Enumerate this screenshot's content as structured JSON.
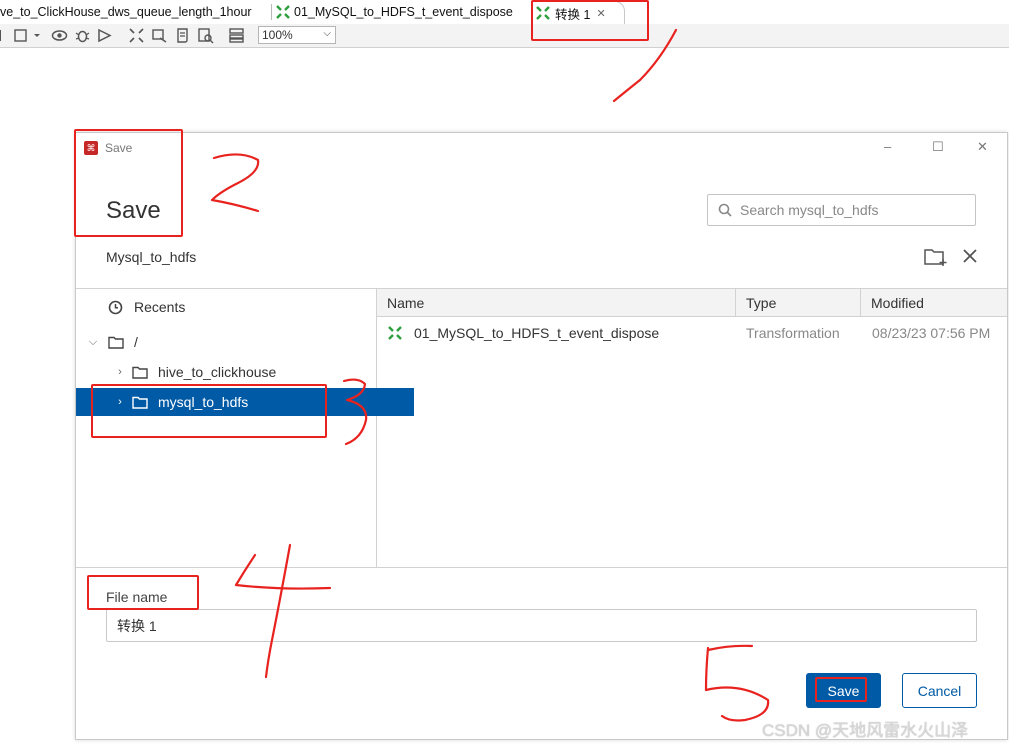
{
  "tabs": [
    {
      "label": "ve_to_ClickHouse_dws_queue_length_1hour"
    },
    {
      "label": "01_MySQL_to_HDFS_t_event_dispose"
    },
    {
      "label": "转换 1"
    }
  ],
  "toolbar": {
    "zoom": "100%"
  },
  "dialog": {
    "window_title": "Save",
    "heading": "Save",
    "search_placeholder": "Search mysql_to_hdfs",
    "current_path": "Mysql_to_hdfs",
    "tree": {
      "recents": "Recents",
      "root": "/",
      "folders": [
        "hive_to_clickhouse",
        "mysql_to_hdfs"
      ]
    },
    "columns": {
      "name": "Name",
      "type": "Type",
      "modified": "Modified"
    },
    "files": [
      {
        "name": "01_MySQL_to_HDFS_t_event_dispose",
        "type": "Transformation",
        "modified": "08/23/23 07:56 PM"
      }
    ],
    "file_name_label": "File name",
    "file_name_value": "转换 1",
    "save_button": "Save",
    "cancel_button": "Cancel"
  },
  "watermark": "CSDN @天地风雷水火山泽",
  "colors": {
    "accent": "#005aa5",
    "annotation": "#e8231f"
  }
}
